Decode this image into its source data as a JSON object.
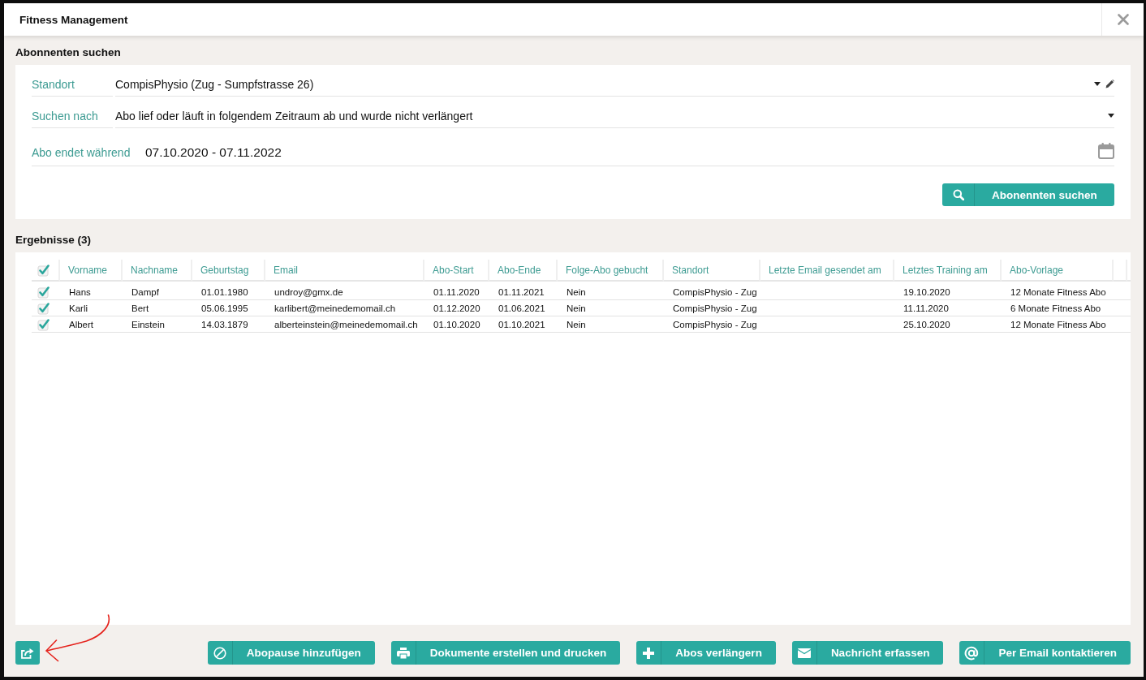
{
  "window": {
    "title": "Fitness Management"
  },
  "search": {
    "heading": "Abonnenten suchen",
    "fields": [
      {
        "kind": "select",
        "label": "Standort",
        "value": "CompisPhysio (Zug - Sumpfstrasse 26)",
        "editable": true
      },
      {
        "kind": "select",
        "label": "Suchen nach",
        "value": "Abo lief oder läuft in folgendem Zeitraum ab und wurde nicht verlängert",
        "editable": false
      },
      {
        "kind": "daterange",
        "label": "Abo endet während",
        "value": "07.10.2020 - 07.11.2022",
        "editable": false
      }
    ],
    "button": "Abonennten suchen"
  },
  "results": {
    "heading": "Ergebnisse (3)",
    "all_checked": true,
    "columns": [
      "Vorname",
      "Nachname",
      "Geburtstag",
      "Email",
      "Abo-Start",
      "Abo-Ende",
      "Folge-Abo gebucht",
      "Standort",
      "Letzte Email gesendet am",
      "Letztes Training am",
      "Abo-Vorlage"
    ],
    "rows": [
      {
        "checked": true,
        "cells": [
          "Hans",
          "Dampf",
          "01.01.1980",
          "undroy@gmx.de",
          "01.11.2020",
          "01.11.2021",
          "Nein",
          "CompisPhysio - Zug",
          null,
          "19.10.2020",
          "12 Monate Fitness Abo"
        ]
      },
      {
        "checked": true,
        "cells": [
          "Karli",
          "Bert",
          "05.06.1995",
          "karlibert@meinedemomail.ch",
          "01.12.2020",
          "01.06.2021",
          "Nein",
          "CompisPhysio - Zug",
          null,
          "11.11.2020",
          "6 Monate Fitness Abo"
        ]
      },
      {
        "checked": true,
        "cells": [
          "Albert",
          "Einstein",
          "14.03.1879",
          "alberteinstein@meinedemomail.ch",
          "01.10.2020",
          "01.10.2021",
          "Nein",
          "CompisPhysio - Zug",
          null,
          "25.10.2020",
          "12 Monate Fitness Abo"
        ]
      }
    ]
  },
  "footer": {
    "buttons": [
      {
        "kind": "export"
      },
      {
        "kind": "pause",
        "label": "Abopause hinzufügen"
      },
      {
        "kind": "print",
        "label": "Dokumente erstellen und drucken"
      },
      {
        "kind": "add",
        "label": "Abos verlängern"
      },
      {
        "kind": "message",
        "label": "Nachricht erfassen"
      },
      {
        "kind": "email",
        "label": "Per Email kontaktieren"
      }
    ]
  }
}
